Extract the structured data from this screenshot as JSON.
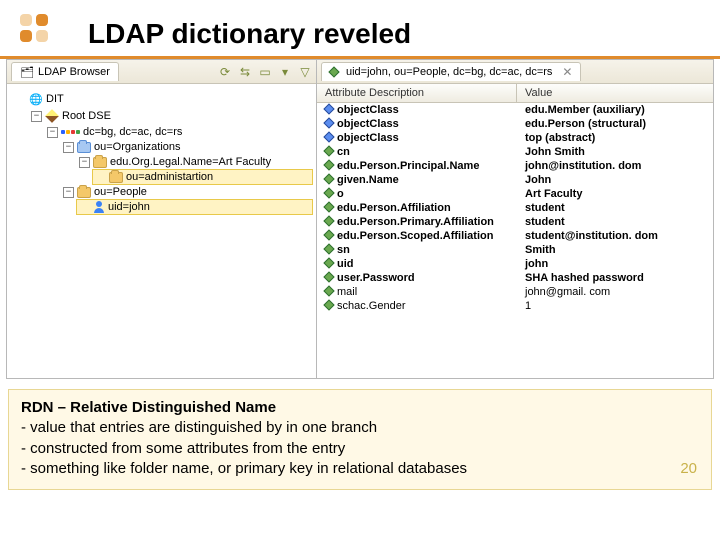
{
  "slide": {
    "title": "LDAP dictionary reveled",
    "page_number": "20"
  },
  "browser": {
    "tab_label": "LDAP Browser",
    "tree": {
      "root": "DIT",
      "root_dse": "Root DSE",
      "dc": "dc=bg, dc=ac, dc=rs",
      "orgs": "ou=Organizations",
      "art_faculty": "edu.Org.Legal.Name=Art Faculty",
      "admin": "ou=administartion",
      "people": "ou=People",
      "uid_john": "uid=john"
    }
  },
  "entry": {
    "tab_label": "uid=john, ou=People, dc=bg, dc=ac, dc=rs",
    "headers": {
      "attr": "Attribute Description",
      "value": "Value"
    },
    "rows": [
      {
        "a": "objectClass",
        "v": "edu.Member (auxiliary)",
        "b": true
      },
      {
        "a": "objectClass",
        "v": "edu.Person (structural)",
        "b": true
      },
      {
        "a": "objectClass",
        "v": "top (abstract)",
        "b": true
      },
      {
        "a": "cn",
        "v": "John Smith",
        "b": true
      },
      {
        "a": "edu.Person.Principal.Name",
        "v": "john@institution. dom",
        "b": true
      },
      {
        "a": "given.Name",
        "v": "John",
        "b": true
      },
      {
        "a": "o",
        "v": "Art Faculty",
        "b": true
      },
      {
        "a": "edu.Person.Affiliation",
        "v": "student",
        "b": true
      },
      {
        "a": "edu.Person.Primary.Affiliation",
        "v": "student",
        "b": true
      },
      {
        "a": "edu.Person.Scoped.Affiliation",
        "v": "student@institution. dom",
        "b": true
      },
      {
        "a": "sn",
        "v": "Smith",
        "b": true
      },
      {
        "a": "uid",
        "v": "john",
        "b": true
      },
      {
        "a": "user.Password",
        "v": "SHA hashed password",
        "b": true
      },
      {
        "a": "mail",
        "v": "john@gmail. com",
        "b": false
      },
      {
        "a": "schac.Gender",
        "v": "1",
        "b": false
      }
    ]
  },
  "footer": {
    "heading": "RDN – Relative Distinguished Name",
    "l1": " - value that entries are distinguished by in one branch",
    "l2": " - constructed from some attributes from the entry",
    "l3": " - something like folder name, or primary key in relational databases"
  }
}
